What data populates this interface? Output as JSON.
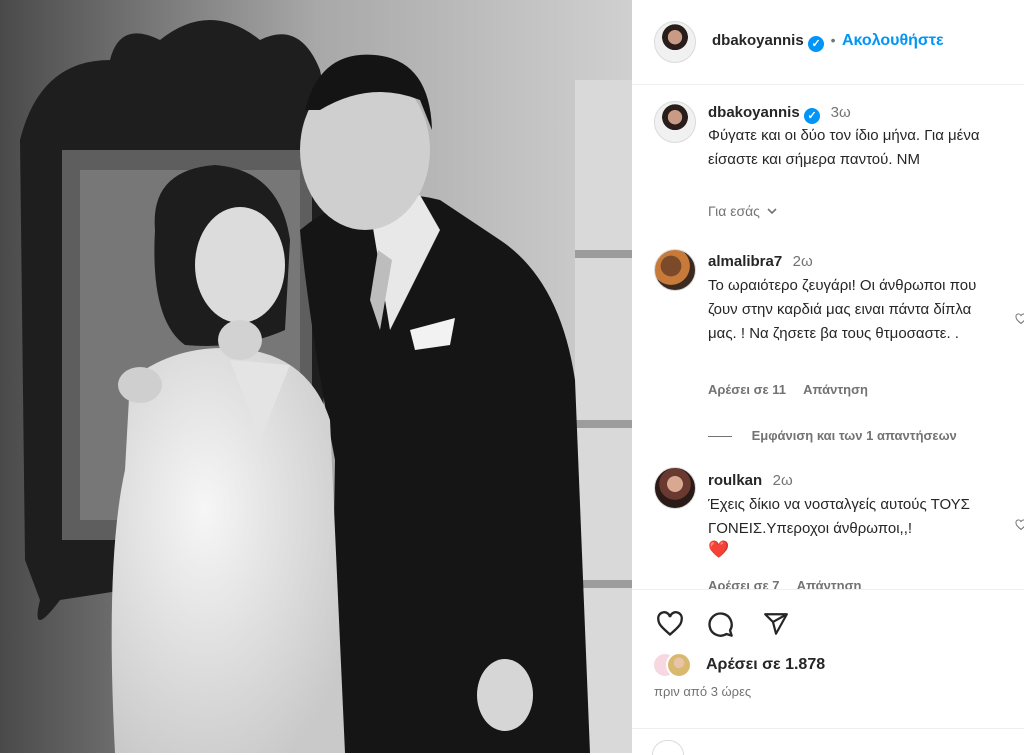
{
  "header": {
    "username": "dbakoyannis",
    "follow_label": "Ακολουθήστε",
    "separator": "•"
  },
  "caption": {
    "username": "dbakoyannis",
    "time": "3ω",
    "text": "Φύγατε και οι δύο τον ίδιο μήνα. Για μένα είσαστε και σήμερα παντού. ΝΜ",
    "translation_label": "Για εσάς",
    "translation_icon": "chevron-down-icon"
  },
  "comments": [
    {
      "username": "almalibra7",
      "time": "2ω",
      "text": "Το ωραιότερο ζευγάρι! Οι άνθρωποι που ζουν στην καρδιά μας ειναι πάντα δίπλα μας. ! Να ζησετε βα τους θτμοσαστε. .",
      "likes_label": "Αρέσει σε 11",
      "reply_label": "Απάντηση",
      "view_replies_label": "Εμφάνιση και των 1 απαντήσεων"
    },
    {
      "username": "roulkan",
      "time": "2ω",
      "text": "Έχεις δίκιο να νοσταλγείς αυτούς ΤΟΥΣ ΓΟΝΕΙΣ.Υπεροχοι άνθρωποι,,!",
      "emoji": "❤️",
      "likes_label": "Αρέσει σε 7",
      "reply_label": "Απάντηση"
    }
  ],
  "actions": {
    "like_icon": "heart-icon",
    "comment_icon": "comment-icon",
    "share_icon": "share-icon"
  },
  "likes": {
    "label": "Αρέσει σε 1.878"
  },
  "posted": {
    "label": "πριν από 3 ώρες"
  },
  "colors": {
    "accent": "#0095f6",
    "heart": "#ed4956",
    "muted": "#737373"
  }
}
